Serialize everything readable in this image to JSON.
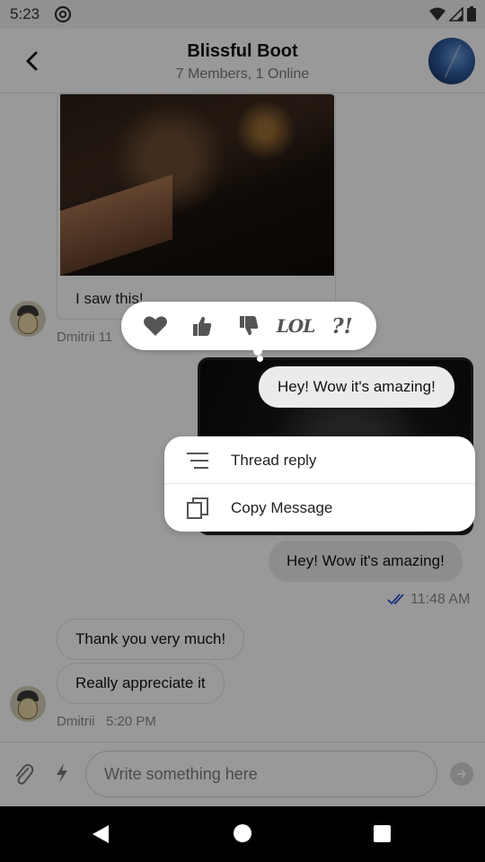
{
  "status_bar": {
    "time": "5:23"
  },
  "header": {
    "title": "Blissful Boot",
    "subtitle": "7 Members, 1 Online"
  },
  "messages": {
    "image_caption": "I saw this!",
    "first_meta": "Dmitrii  11",
    "highlighted_text": "Hey! Wow it's amazing!",
    "outgoing_text": "Hey! Wow it's amazing!",
    "outgoing_time": "11:48 AM",
    "incoming": [
      {
        "text": "Thank you very much!"
      },
      {
        "text": "Really appreciate it"
      }
    ],
    "last_meta": {
      "author": "Dmitrii",
      "time": "5:20 PM"
    }
  },
  "reactions": {
    "items": [
      {
        "icon": "heart-icon"
      },
      {
        "icon": "thumbs-up-icon"
      },
      {
        "icon": "thumbs-down-icon"
      },
      {
        "icon": "lol-icon",
        "text": "LOL"
      },
      {
        "icon": "wow-icon",
        "text": "?!"
      }
    ]
  },
  "context_menu": {
    "items": [
      {
        "label": "Thread reply",
        "icon": "thread-reply-icon"
      },
      {
        "label": "Copy Message",
        "icon": "copy-icon"
      }
    ]
  },
  "composer": {
    "placeholder": "Write something here"
  },
  "colors": {
    "read_receipt": "#2b50d8",
    "overlay": "rgba(0,0,0,0.40)"
  }
}
